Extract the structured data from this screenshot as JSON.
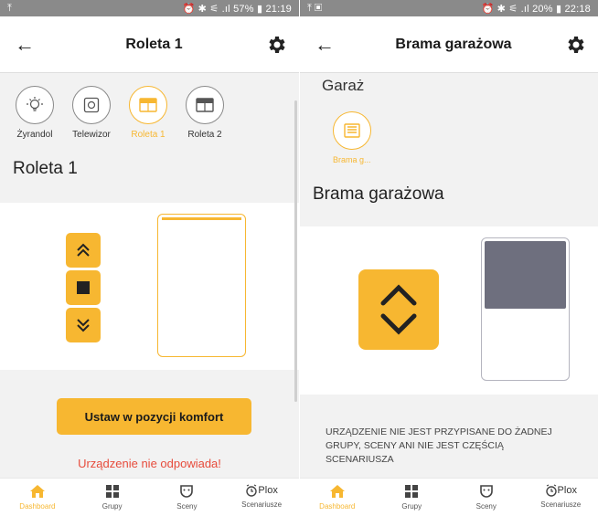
{
  "left": {
    "status": {
      "left": "⤒",
      "right": "⏰ ✱ ⚟ .ıl 57% ▮ 21:19"
    },
    "title": "Roleta 1",
    "devices": [
      {
        "label": "Żyrandol",
        "icon": "bulb-icon",
        "active": false
      },
      {
        "label": "Telewizor",
        "icon": "socket-icon",
        "active": false
      },
      {
        "label": "Roleta 1",
        "icon": "blind-icon",
        "active": true
      },
      {
        "label": "Roleta 2",
        "icon": "blind-icon",
        "active": false
      }
    ],
    "section_title": "Roleta 1",
    "comfort_label": "Ustaw w pozycji komfort",
    "error_text": "Urządzenie nie odpowiada!"
  },
  "right": {
    "status": {
      "left": "⤒ ▣",
      "right": "⏰ ✱ ⚟ .ıl 20% ▮ 22:18"
    },
    "title": "Brama garażowa",
    "group_title": "Garaż",
    "device_label": "Brama g...",
    "section_title": "Brama garażowa",
    "notice": "Urządzenie nie jest przypisane do żadnej grupy, sceny ani nie jest częścią scenariusza"
  },
  "nav": [
    {
      "label": "Dashboard",
      "icon": "home-icon",
      "active": true
    },
    {
      "label": "Grupy",
      "icon": "grid-icon",
      "active": false
    },
    {
      "label": "Sceny",
      "icon": "mask-icon",
      "active": false
    },
    {
      "label": "Scenariusze",
      "icon": "alarm-clock-icon",
      "active": false
    }
  ],
  "brand": "Plox",
  "colors": {
    "accent": "#f7b731",
    "error": "#e74c3c",
    "background": "#f2f2f2"
  }
}
